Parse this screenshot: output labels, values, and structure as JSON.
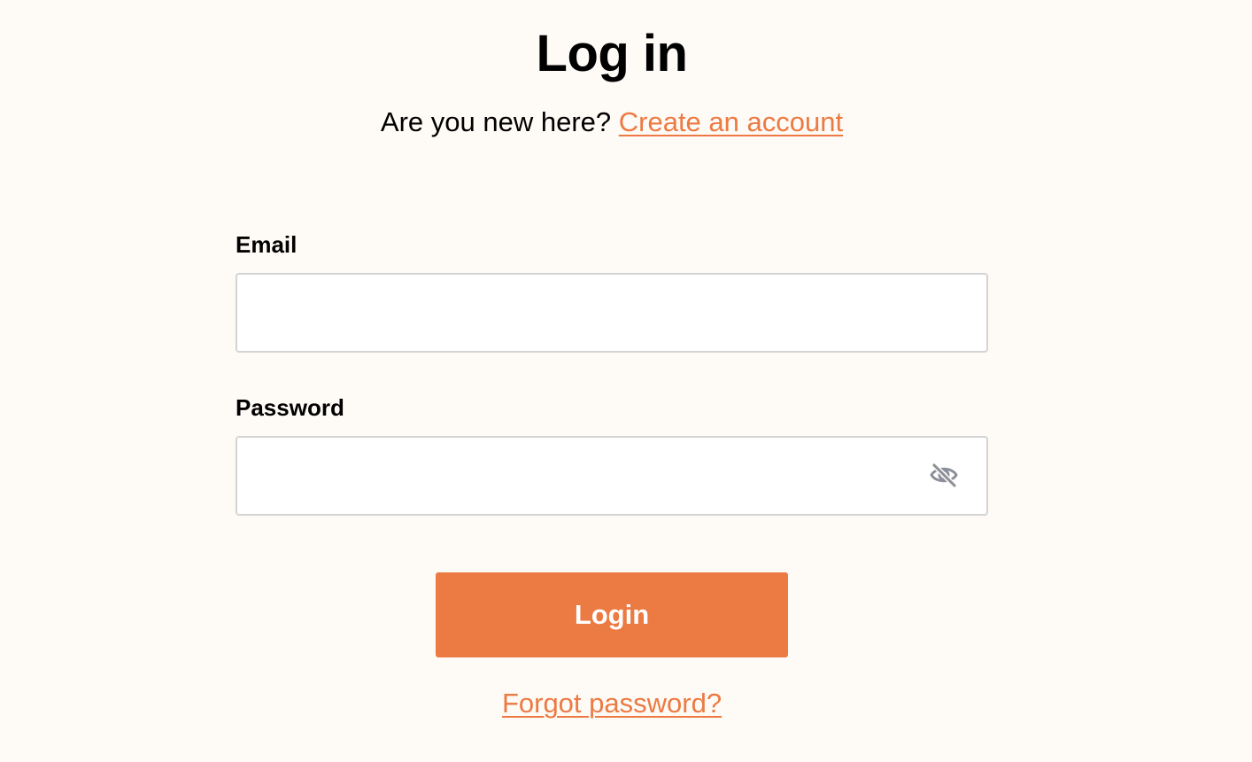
{
  "header": {
    "title": "Log in",
    "new_here_text": "Are you new here?",
    "create_account_link": "Create an account"
  },
  "form": {
    "email": {
      "label": "Email",
      "value": "",
      "placeholder": ""
    },
    "password": {
      "label": "Password",
      "value": "",
      "placeholder": "",
      "visibility_icon": "eye-slash-icon"
    },
    "login_button": "Login",
    "forgot_password_link": "Forgot password?"
  },
  "colors": {
    "background": "#fefaf5",
    "accent": "#ec7a43",
    "text": "#000000",
    "input_border": "#d4d4d4",
    "icon": "#8a8f99"
  }
}
